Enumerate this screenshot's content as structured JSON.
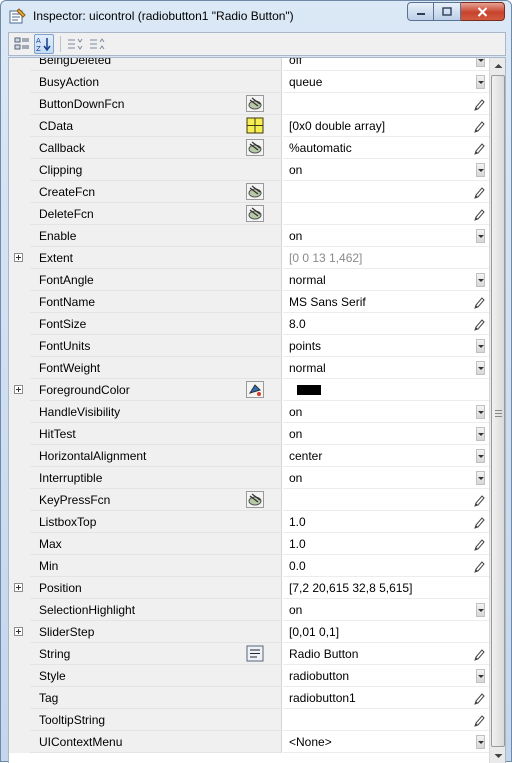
{
  "window": {
    "title": "Inspector:  uicontrol (radiobutton1 \"Radio Button\")",
    "accent": "#c7432d"
  },
  "toolbar": {
    "buttons": [
      {
        "icon": "categorized-view-icon"
      },
      {
        "icon": "alphabetical-sort-icon"
      },
      {
        "icon": "expand-all-icon"
      },
      {
        "icon": "collapse-all-icon"
      }
    ]
  },
  "properties": [
    {
      "name": "BeingDeleted",
      "value": "off",
      "editor": "dropdown"
    },
    {
      "name": "BusyAction",
      "value": "queue",
      "editor": "dropdown"
    },
    {
      "name": "ButtonDownFcn",
      "value": "",
      "editor": "pencil",
      "action": "callback-editor-icon"
    },
    {
      "name": "CData",
      "value": "[0x0  double array]",
      "editor": "pencil",
      "action": "array-editor-icon"
    },
    {
      "name": "Callback",
      "value": "%automatic",
      "editor": "pencil",
      "action": "callback-editor-icon"
    },
    {
      "name": "Clipping",
      "value": "on",
      "editor": "dropdown"
    },
    {
      "name": "CreateFcn",
      "value": "",
      "editor": "pencil",
      "action": "callback-editor-icon"
    },
    {
      "name": "DeleteFcn",
      "value": "",
      "editor": "pencil",
      "action": "callback-editor-icon"
    },
    {
      "name": "Enable",
      "value": "on",
      "editor": "dropdown"
    },
    {
      "name": "Extent",
      "value": "[0 0 13 1,462]",
      "editor": "none",
      "expandable": true,
      "readonly": true
    },
    {
      "name": "FontAngle",
      "value": "normal",
      "editor": "dropdown"
    },
    {
      "name": "FontName",
      "value": "MS Sans Serif",
      "editor": "pencil"
    },
    {
      "name": "FontSize",
      "value": "8.0",
      "editor": "pencil"
    },
    {
      "name": "FontUnits",
      "value": "points",
      "editor": "dropdown"
    },
    {
      "name": "FontWeight",
      "value": "normal",
      "editor": "dropdown"
    },
    {
      "name": "ForegroundColor",
      "value": "",
      "editor": "none",
      "expandable": true,
      "action": "color-picker-icon",
      "swatch": "#000000"
    },
    {
      "name": "HandleVisibility",
      "value": "on",
      "editor": "dropdown"
    },
    {
      "name": "HitTest",
      "value": "on",
      "editor": "dropdown"
    },
    {
      "name": "HorizontalAlignment",
      "value": "center",
      "editor": "dropdown"
    },
    {
      "name": "Interruptible",
      "value": "on",
      "editor": "dropdown"
    },
    {
      "name": "KeyPressFcn",
      "value": "",
      "editor": "pencil",
      "action": "callback-editor-icon"
    },
    {
      "name": "ListboxTop",
      "value": "1.0",
      "editor": "pencil"
    },
    {
      "name": "Max",
      "value": "1.0",
      "editor": "pencil"
    },
    {
      "name": "Min",
      "value": "0.0",
      "editor": "pencil"
    },
    {
      "name": "Position",
      "value": "[7,2 20,615 32,8 5,615]",
      "editor": "none",
      "expandable": true
    },
    {
      "name": "SelectionHighlight",
      "value": "on",
      "editor": "dropdown"
    },
    {
      "name": "SliderStep",
      "value": "[0,01 0,1]",
      "editor": "none",
      "expandable": true
    },
    {
      "name": "String",
      "value": "Radio Button",
      "editor": "pencil",
      "action": "string-editor-icon"
    },
    {
      "name": "Style",
      "value": "radiobutton",
      "editor": "dropdown"
    },
    {
      "name": "Tag",
      "value": "radiobutton1",
      "editor": "pencil"
    },
    {
      "name": "TooltipString",
      "value": "",
      "editor": "pencil"
    },
    {
      "name": "UIContextMenu",
      "value": "<None>",
      "editor": "dropdown"
    }
  ]
}
